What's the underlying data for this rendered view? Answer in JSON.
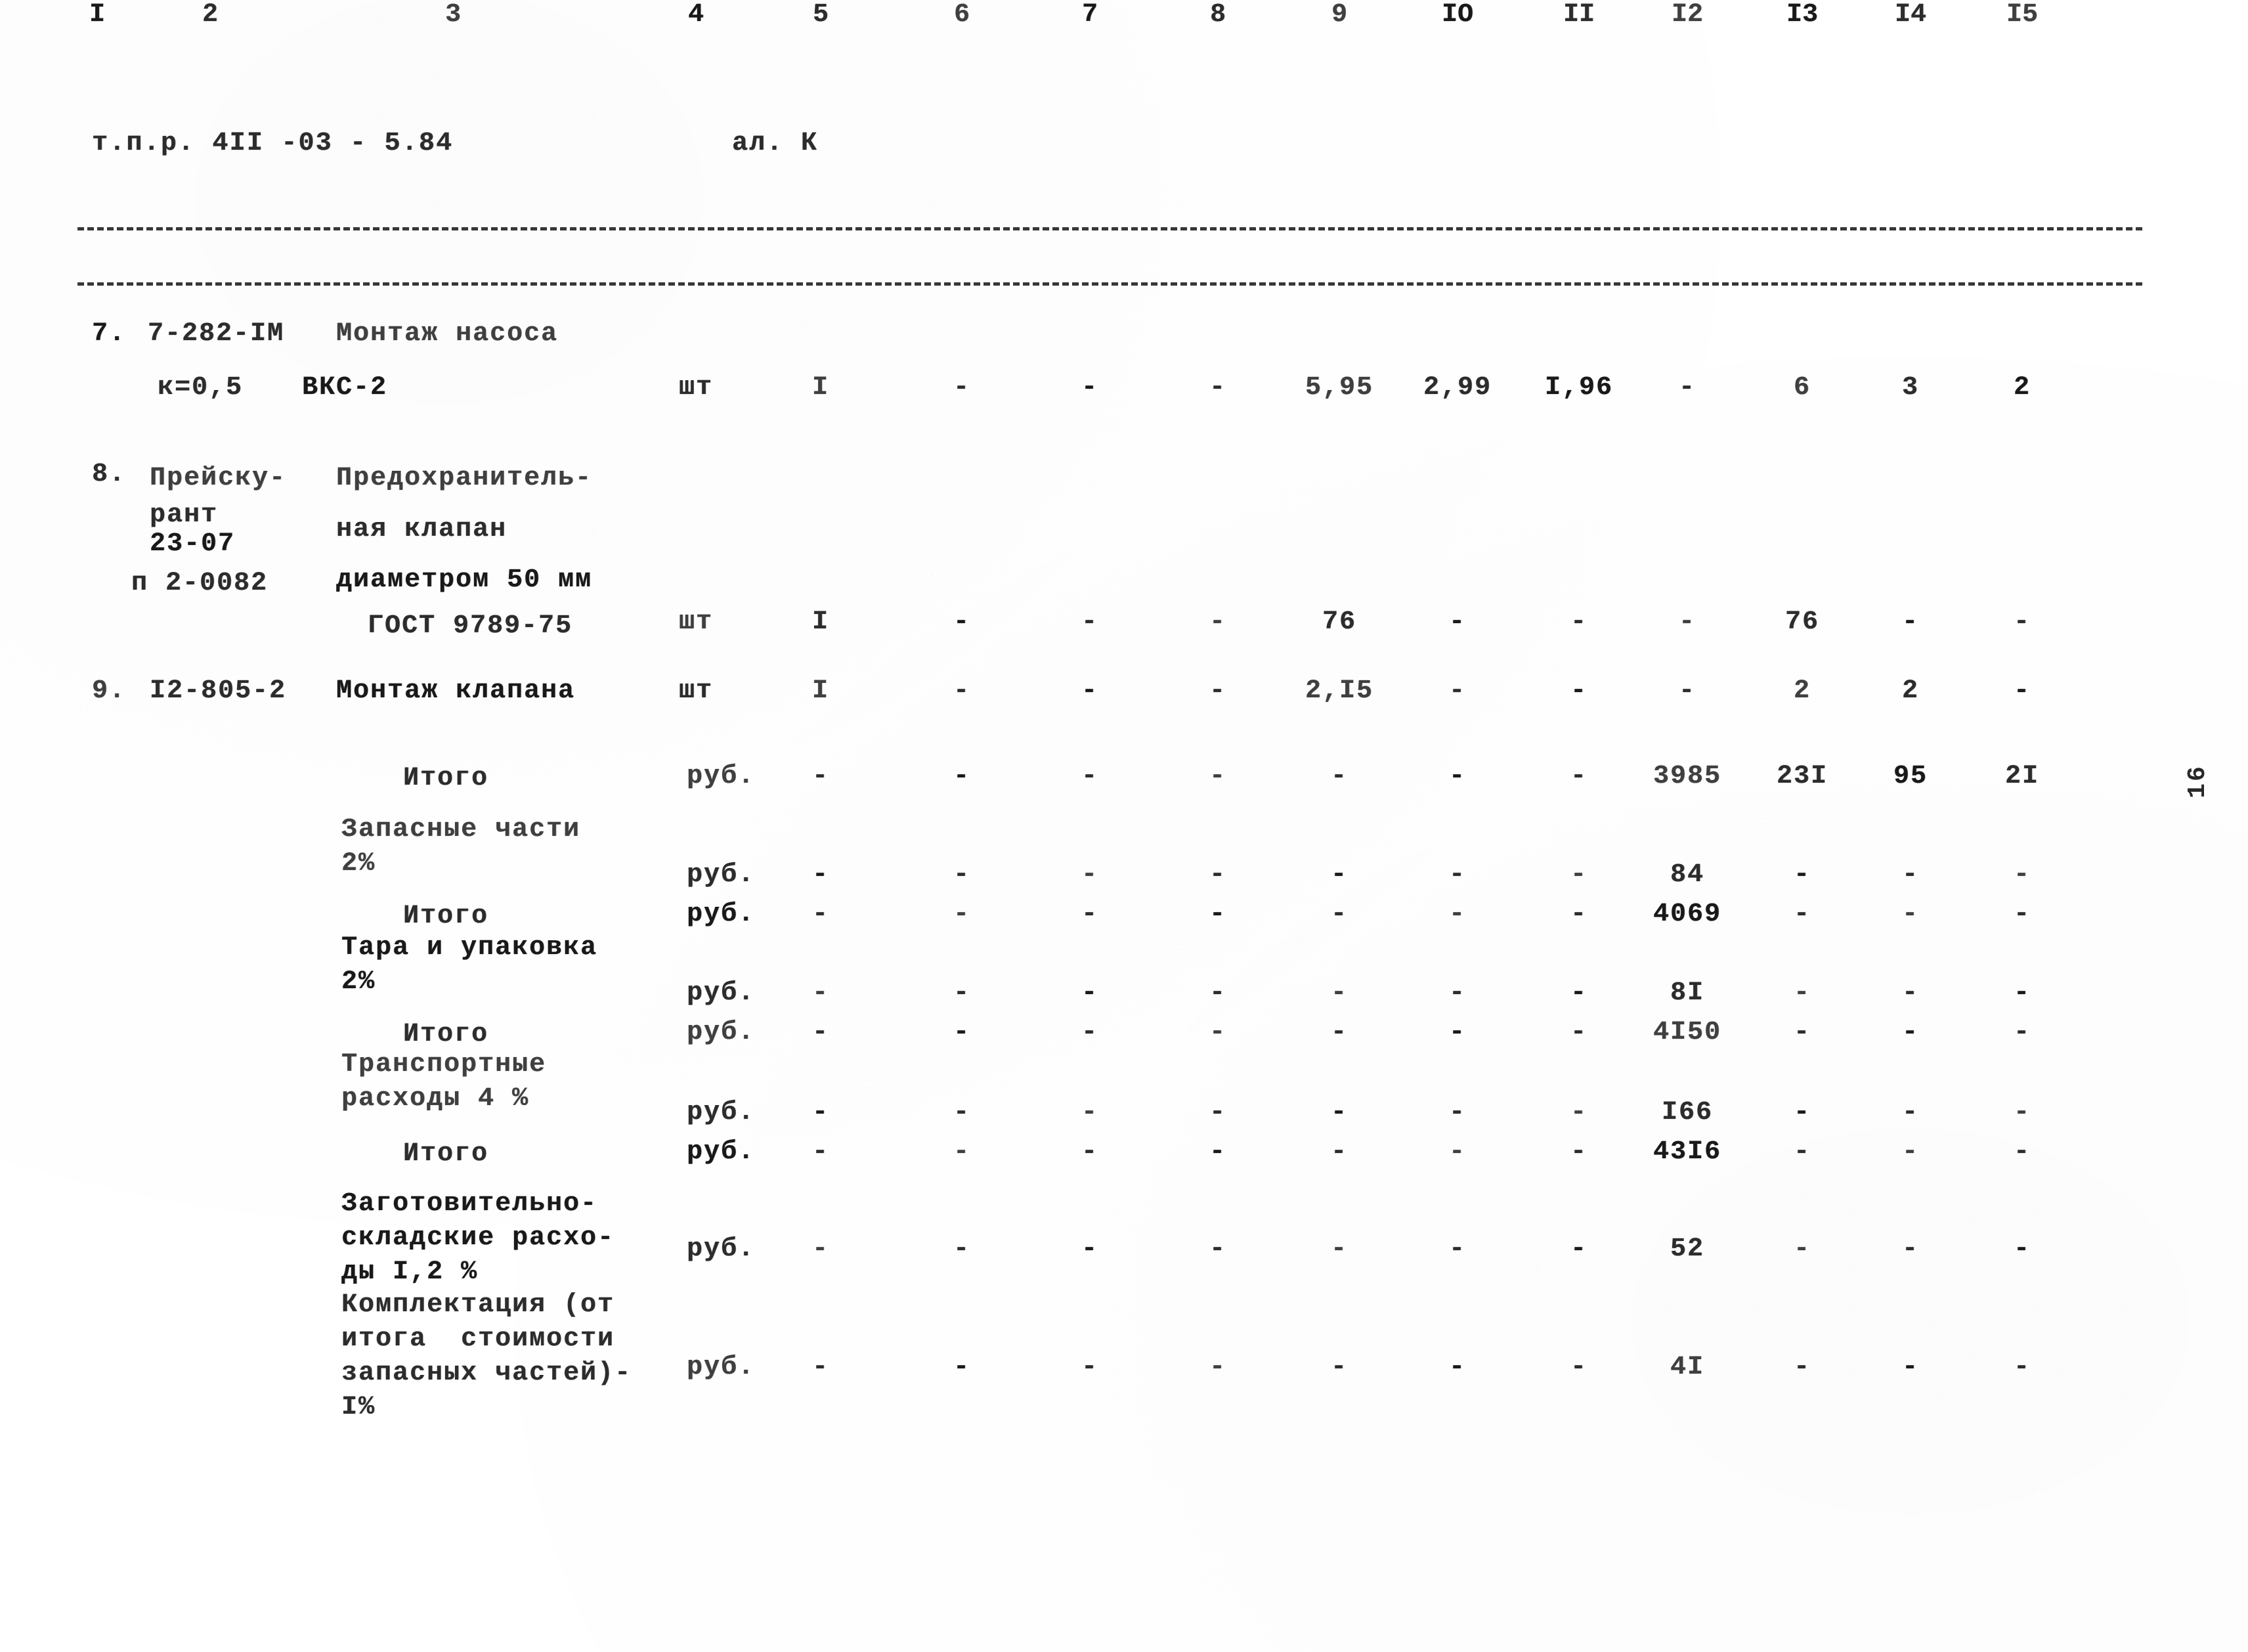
{
  "document": {
    "header_code": "т.п.р. 4II -03 - 5.84",
    "album_label": "ал. К",
    "page_marker": "16"
  },
  "table": {
    "column_numbers": [
      "I",
      "2",
      "3",
      "4",
      "5",
      "6",
      "7",
      "8",
      "9",
      "IO",
      "II",
      "I2",
      "I3",
      "I4",
      "I5"
    ],
    "column_x": [
      148,
      320,
      690,
      1060,
      1250,
      1465,
      1660,
      1855,
      2040,
      2220,
      2405,
      2570,
      2745,
      2910,
      3080
    ],
    "dash_symbol": "-",
    "rows": [
      {
        "no": "7.",
        "code": "7-282-IМ",
        "description_line1": "Монтаж насоса",
        "code_line2": "к=0,5",
        "description_line2": "ВКС-2",
        "unit": "шт",
        "qty": "I",
        "c6": "-",
        "c7": "-",
        "c8": "-",
        "c9": "5,95",
        "c10": "2,99",
        "c11": "I,96",
        "c12": "-",
        "c13": "6",
        "c14": "3",
        "c15": "2"
      },
      {
        "no": "8.",
        "code_lines": [
          "Прейску-",
          "рант",
          "23-07",
          "п 2-0082"
        ],
        "description_lines": [
          "Предохранитель-",
          "ная клапан",
          "диаметром 50 мм",
          "ГОСТ 9789-75"
        ],
        "unit": "шт",
        "qty": "I",
        "c6": "-",
        "c7": "-",
        "c8": "-",
        "c9": "76",
        "c10": "-",
        "c11": "-",
        "c12": "-",
        "c13": "76",
        "c14": "-",
        "c15": "-"
      },
      {
        "no": "9.",
        "code": "I2-805-2",
        "description": "Монтаж клапана",
        "unit": "шт",
        "qty": "I",
        "c6": "-",
        "c7": "-",
        "c8": "-",
        "c9": "2,I5",
        "c10": "-",
        "c11": "-",
        "c12": "-",
        "c13": "2",
        "c14": "2",
        "c15": "-"
      }
    ],
    "summary_rows": [
      {
        "label_lines": [
          "Итого"
        ],
        "label_indent": "center",
        "unit": "руб.",
        "c5": "-",
        "c6": "-",
        "c7": "-",
        "c8": "-",
        "c9": "-",
        "c10": "-",
        "c11": "-",
        "c12": "3985",
        "c13": "23I",
        "c14": "95",
        "c15": "2I"
      },
      {
        "label_lines": [
          "Запасные части",
          "2%"
        ],
        "label_indent": "left",
        "unit": "руб.",
        "c5": "-",
        "c6": "-",
        "c7": "-",
        "c8": "-",
        "c9": "-",
        "c10": "-",
        "c11": "-",
        "c12": "84",
        "c13": "-",
        "c14": "-",
        "c15": "-"
      },
      {
        "label_lines": [
          "Итого"
        ],
        "label_indent": "center",
        "unit": "руб.",
        "c5": "-",
        "c6": "-",
        "c7": "-",
        "c8": "-",
        "c9": "-",
        "c10": "-",
        "c11": "-",
        "c12": "4069",
        "c13": "-",
        "c14": "-",
        "c15": "-"
      },
      {
        "label_lines": [
          "Тара и упаковка",
          "2%"
        ],
        "label_indent": "left",
        "unit": "руб.",
        "c5": "-",
        "c6": "-",
        "c7": "-",
        "c8": "-",
        "c9": "-",
        "c10": "-",
        "c11": "-",
        "c12": "8I",
        "c13": "-",
        "c14": "-",
        "c15": "-"
      },
      {
        "label_lines": [
          "Итого"
        ],
        "label_indent": "center",
        "unit": "руб.",
        "c5": "-",
        "c6": "-",
        "c7": "-",
        "c8": "-",
        "c9": "-",
        "c10": "-",
        "c11": "-",
        "c12": "4I50",
        "c13": "-",
        "c14": "-",
        "c15": "-"
      },
      {
        "label_lines": [
          "Транспортные",
          "расходы 4 %"
        ],
        "label_indent": "left",
        "unit": "руб.",
        "c5": "-",
        "c6": "-",
        "c7": "-",
        "c8": "-",
        "c9": "-",
        "c10": "-",
        "c11": "-",
        "c12": "I66",
        "c13": "-",
        "c14": "-",
        "c15": "-"
      },
      {
        "label_lines": [
          "Итого"
        ],
        "label_indent": "center",
        "unit": "руб.",
        "c5": "-",
        "c6": "-",
        "c7": "-",
        "c8": "-",
        "c9": "-",
        "c10": "-",
        "c11": "-",
        "c12": "43I6",
        "c13": "-",
        "c14": "-",
        "c15": "-"
      },
      {
        "label_lines": [
          "Заготовительно-",
          "складские расхо-",
          "ды I,2 %"
        ],
        "label_indent": "left",
        "unit": "руб.",
        "c5": "-",
        "c6": "-",
        "c7": "-",
        "c8": "-",
        "c9": "-",
        "c10": "-",
        "c11": "-",
        "c12": "52",
        "c13": "-",
        "c14": "-",
        "c15": "-"
      },
      {
        "label_lines": [
          "Комплектация (от",
          "итога  стоимости",
          "запасных частей)-",
          "I%"
        ],
        "label_indent": "left",
        "unit": "руб.",
        "c5": "-",
        "c6": "-",
        "c7": "-",
        "c8": "-",
        "c9": "-",
        "c10": "-",
        "c11": "-",
        "c12": "4I",
        "c13": "-",
        "c14": "-",
        "c15": "-"
      }
    ]
  }
}
